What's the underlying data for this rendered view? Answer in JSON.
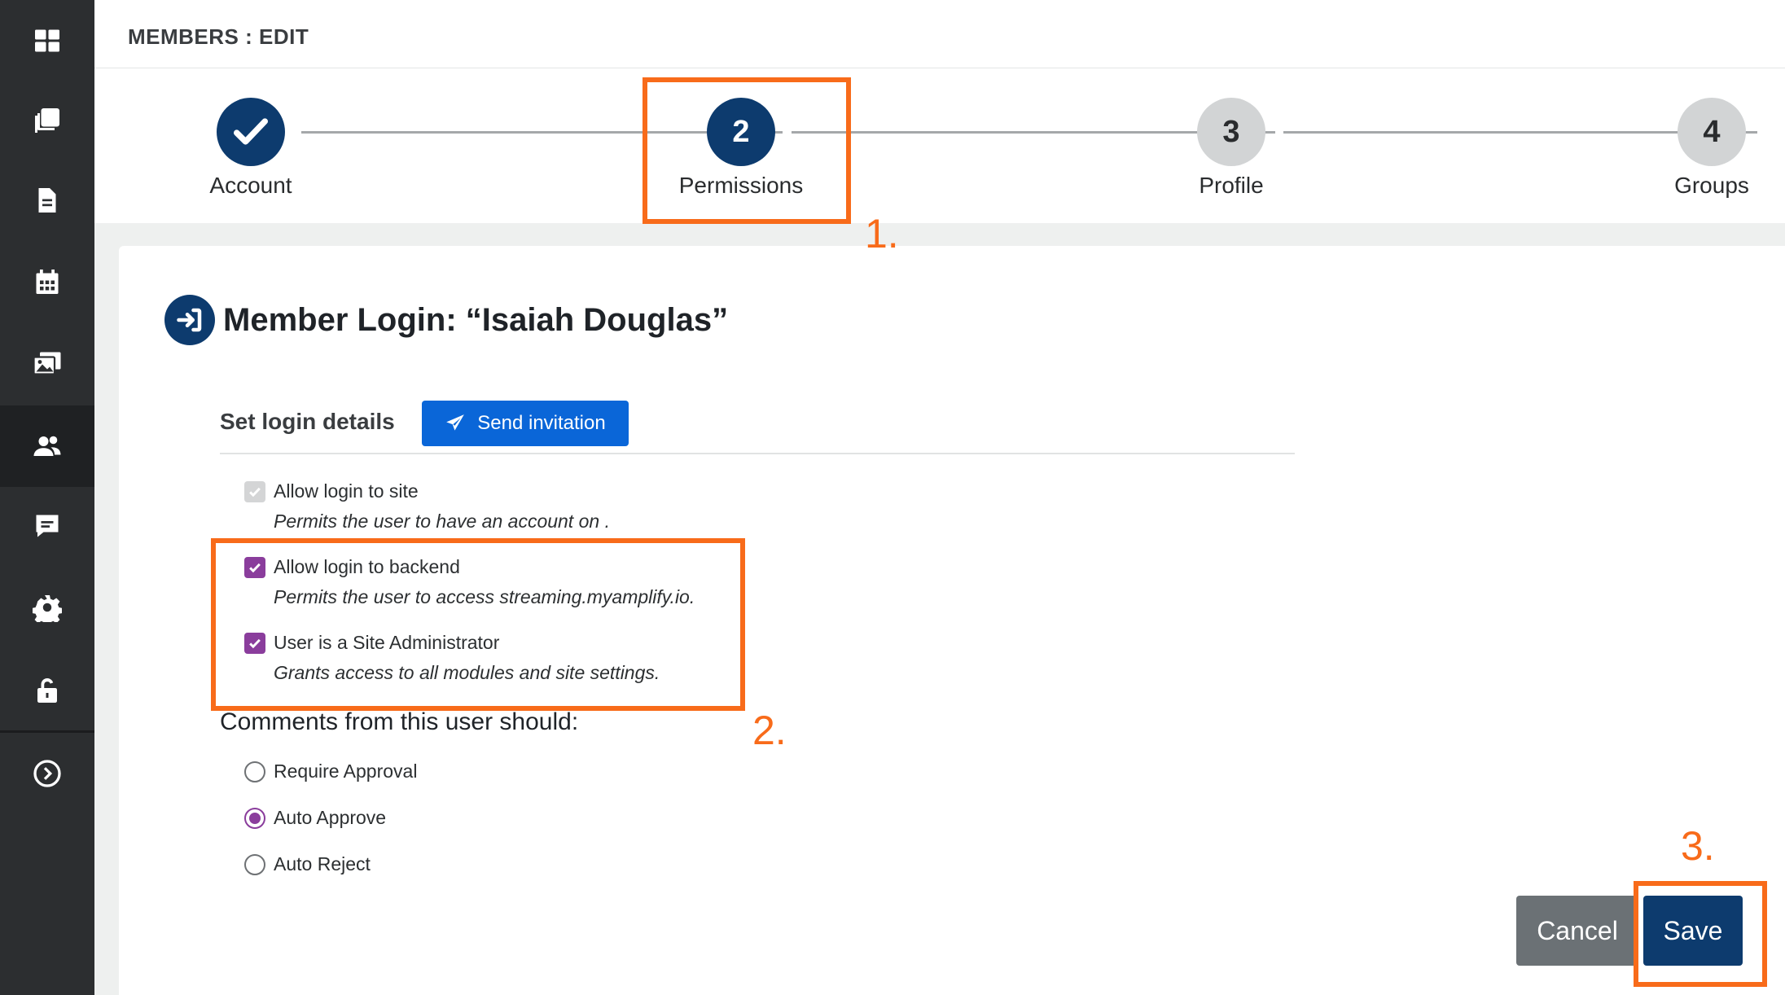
{
  "sidebar": {
    "items": [
      {
        "icon": "dashboard-icon"
      },
      {
        "icon": "stacked-pages-icon"
      },
      {
        "icon": "document-icon"
      },
      {
        "icon": "calendar-icon"
      },
      {
        "icon": "gallery-icon"
      },
      {
        "icon": "members-icon"
      },
      {
        "icon": "comments-icon"
      },
      {
        "icon": "gear-icon"
      },
      {
        "icon": "unlock-icon"
      },
      {
        "icon": "expand-circle-icon"
      }
    ]
  },
  "header": {
    "breadcrumb": "MEMBERS : EDIT"
  },
  "stepper": {
    "steps": [
      {
        "number": "1",
        "label": "Account",
        "state": "done"
      },
      {
        "number": "2",
        "label": "Permissions",
        "state": "current"
      },
      {
        "number": "3",
        "label": "Profile",
        "state": "todo"
      },
      {
        "number": "4",
        "label": "Groups",
        "state": "todo"
      }
    ]
  },
  "card": {
    "title": "Member Login: “Isaiah Douglas”",
    "tab_label": "Set login details",
    "invite_button": "Send invitation",
    "options": [
      {
        "label": "Allow login to site",
        "description": "Permits the user to have an account on .",
        "state": "checked-disabled"
      },
      {
        "label": "Allow login to backend",
        "description": "Permits the user to access streaming.myamplify.io.",
        "state": "checked"
      },
      {
        "label": "User is a Site Administrator",
        "description": "Grants access to all modules and site settings.",
        "state": "checked"
      }
    ],
    "comments_heading": "Comments from this user should:",
    "comment_options": [
      {
        "label": "Require Approval",
        "selected": false
      },
      {
        "label": "Auto Approve",
        "selected": true
      },
      {
        "label": "Auto Reject",
        "selected": false
      }
    ],
    "cancel_button": "Cancel",
    "save_button": "Save"
  },
  "annotations": {
    "labels": [
      "1.",
      "2.",
      "3."
    ],
    "color": "#f86b1a"
  },
  "colors": {
    "primary": "#0d3b6e",
    "accent_purple": "#8a3d9c",
    "invite_blue": "#0a66d8",
    "sidebar_bg": "#2c2e30"
  }
}
